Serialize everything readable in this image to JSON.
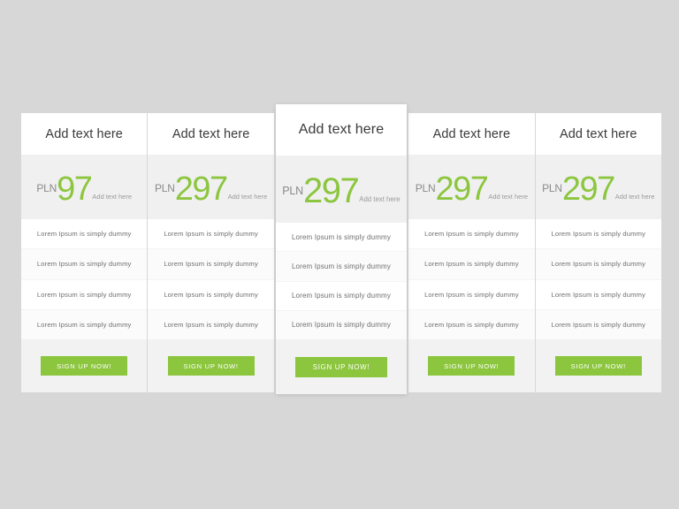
{
  "background_color": "#d7d7d7",
  "accent_color": "#8cc63e",
  "price_band_color": "#f0f0f0",
  "footer_band_color": "#f2f2f2",
  "plans": [
    {
      "title": "Add text here",
      "currency": "PLN",
      "amount": "97",
      "price_note": "Add text here",
      "features": [
        "Lorem Ipsum is simply dummy",
        "Lorem Ipsum is simply dummy",
        "Lorem Ipsum is simply dummy",
        "Lorem Ipsum is simply dummy"
      ],
      "cta_label": "SIGN UP NOW!",
      "featured": false
    },
    {
      "title": "Add text here",
      "currency": "PLN",
      "amount": "297",
      "price_note": "Add text here",
      "features": [
        "Lorem Ipsum is simply dummy",
        "Lorem Ipsum is simply dummy",
        "Lorem Ipsum is simply dummy",
        "Lorem Ipsum is simply dummy"
      ],
      "cta_label": "SIGN UP NOW!",
      "featured": false
    },
    {
      "title": "Add text here",
      "currency": "PLN",
      "amount": "297",
      "price_note": "Add text here",
      "features": [
        "Lorem Ipsum is simply dummy",
        "Lorem Ipsum is simply dummy",
        "Lorem Ipsum is simply dummy",
        "Lorem Ipsum is simply dummy"
      ],
      "cta_label": "SIGN UP NOW!",
      "featured": true
    },
    {
      "title": "Add text here",
      "currency": "PLN",
      "amount": "297",
      "price_note": "Add text here",
      "features": [
        "Lorem Ipsum is simply dummy",
        "Lorem Ipsum is simply dummy",
        "Lorem Ipsum is simply dummy",
        "Lorem Ipsum is simply dummy"
      ],
      "cta_label": "SIGN UP NOW!",
      "featured": false
    },
    {
      "title": "Add text here",
      "currency": "PLN",
      "amount": "297",
      "price_note": "Add text here",
      "features": [
        "Lorem Ipsum is simply dummy",
        "Lorem Ipsum is simply dummy",
        "Lorem Ipsum is simply dummy",
        "Lorem Ipsum is simply dummy"
      ],
      "cta_label": "SIGN UP NOW!",
      "featured": false
    }
  ]
}
